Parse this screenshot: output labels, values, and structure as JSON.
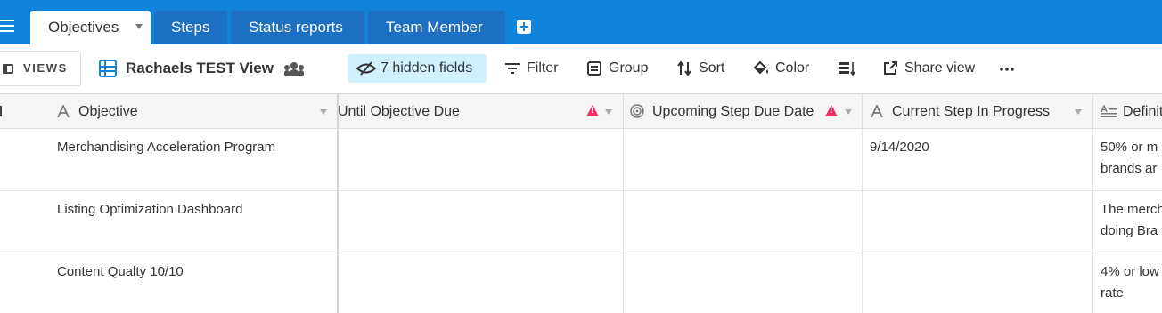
{
  "tabs": [
    {
      "label": "Objectives",
      "active": true
    },
    {
      "label": "Steps",
      "active": false
    },
    {
      "label": "Status reports",
      "active": false
    },
    {
      "label": "Team Member",
      "active": false
    }
  ],
  "viewbar": {
    "views_label": "VIEWS",
    "view_name": "Rachaels TEST View",
    "hidden_fields": "7 hidden fields",
    "filter": "Filter",
    "group": "Group",
    "sort": "Sort",
    "color": "Color",
    "share_view": "Share view"
  },
  "columns": [
    {
      "label": "Objective",
      "icon": "text-field-icon"
    },
    {
      "label": "Until Objective Due",
      "icon": "warning-icon"
    },
    {
      "label": "Upcoming Step Due Date",
      "icon": "spiral-formula-icon"
    },
    {
      "label": "Current Step In Progress",
      "icon": "text-field-icon"
    },
    {
      "label": "Definit",
      "icon": "long-text-icon"
    }
  ],
  "rows": [
    {
      "objective": "Merchandising Acceleration Program",
      "until_due": "",
      "upcoming": "",
      "current_step": "9/14/2020",
      "definition": "50% or m\nbrands ar"
    },
    {
      "objective": "Listing Optimization Dashboard",
      "until_due": "",
      "upcoming": "",
      "current_step": "",
      "definition": "The merch\ndoing Bra"
    },
    {
      "objective": "Content Qualty 10/10",
      "until_due": "",
      "upcoming": "",
      "current_step": "",
      "definition": "4% or low\nrate"
    }
  ],
  "colors": {
    "tabbar": "#1283da",
    "inactive_tab": "#1c6fc2",
    "hidden_fields_bg": "#d0f0fd",
    "warning": "#ef3061"
  }
}
